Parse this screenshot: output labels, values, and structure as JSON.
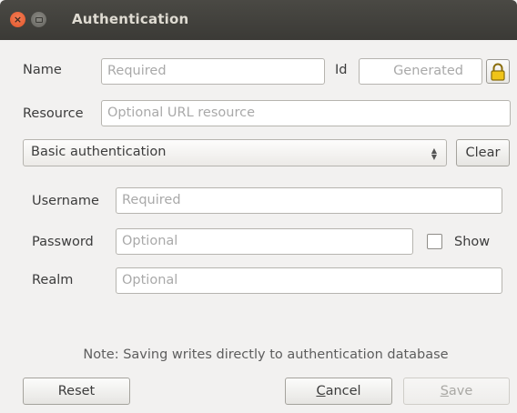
{
  "window": {
    "title": "Authentication",
    "close_symbol": "×",
    "icons": [
      "close-icon",
      "minimize-icon"
    ]
  },
  "form": {
    "name_label": "Name",
    "name_placeholder": "Required",
    "id_label": "Id",
    "id_placeholder": "Generated",
    "lock_icon": "lock-icon",
    "resource_label": "Resource",
    "resource_placeholder": "Optional URL resource"
  },
  "method": {
    "selected": "Basic authentication",
    "clear_label": "Clear"
  },
  "basic": {
    "username_label": "Username",
    "username_placeholder": "Required",
    "password_label": "Password",
    "password_placeholder": "Optional",
    "show_label": "Show",
    "show_checked": false,
    "realm_label": "Realm",
    "realm_placeholder": "Optional"
  },
  "note": "Note: Saving writes directly to authentication database",
  "buttons": {
    "reset": "Reset",
    "cancel_mnemonic": "C",
    "cancel_rest": "ancel",
    "save_mnemonic": "S",
    "save_rest": "ave"
  },
  "colors": {
    "titlebar": "#3b3a36",
    "close_button": "#e0552a",
    "lock_gold": "#f0c419",
    "background": "#f2f1f0"
  }
}
